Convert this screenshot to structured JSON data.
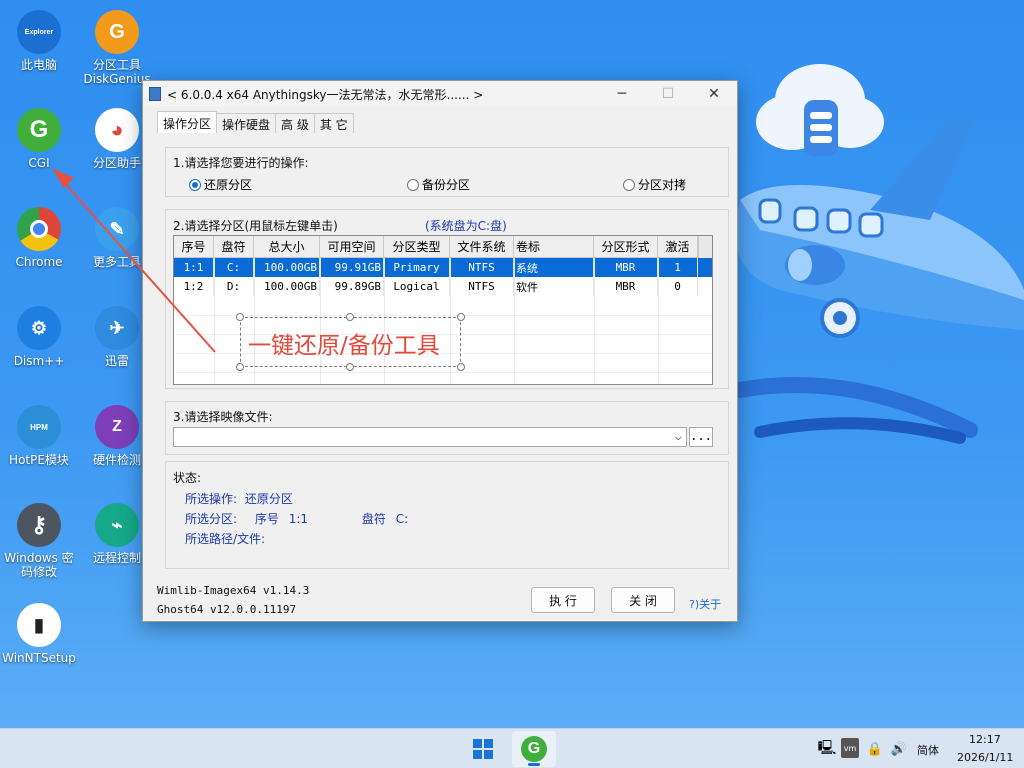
{
  "desktop": {
    "icons": [
      {
        "label": "此电脑",
        "glyph": "Explorer",
        "color": "#1a6fd1"
      },
      {
        "label": "分区工具\nDiskGenius",
        "glyph": "G",
        "color": "#f29a1c"
      },
      {
        "label": "CGI",
        "glyph": "G",
        "color": "#3fae3a"
      },
      {
        "label": "分区助手",
        "glyph": "◕",
        "color": "#ffffff"
      },
      {
        "label": "Chrome",
        "glyph": "●",
        "color": "#ffffff"
      },
      {
        "label": "更多工具",
        "glyph": "✎",
        "color": "#3aa0ee"
      },
      {
        "label": "Dism++",
        "glyph": "⚙",
        "color": "#1f7fe0"
      },
      {
        "label": "迅雷",
        "glyph": "✈",
        "color": "#2f8be0"
      },
      {
        "label": "HotPE模块",
        "glyph": "HPM",
        "color": "#2d8ed8"
      },
      {
        "label": "硬件检测",
        "glyph": "Z",
        "color": "#7d3fb8"
      },
      {
        "label": "Windows 密\n码修改",
        "glyph": "⚷",
        "color": "#4d5560"
      },
      {
        "label": "远程控制",
        "glyph": "⌁",
        "color": "#17a88a"
      },
      {
        "label": "WinNTSetup",
        "glyph": "▮",
        "color": "#ffffff"
      }
    ]
  },
  "annotation": {
    "text": "一键还原/备份工具",
    "color": "#e24a3b"
  },
  "dialog": {
    "title": "< 6.0.0.4 x64 Anythingsky一法无常法，水无常形...... >",
    "tabs": [
      "操作分区",
      "操作硬盘",
      "高 级",
      "其 它"
    ],
    "step1": {
      "label": "1.请选择您要进行的操作:",
      "options": [
        "还原分区",
        "备份分区",
        "分区对拷"
      ],
      "selected": "还原分区"
    },
    "step2": {
      "label": "2.请选择分区(用鼠标左键单击)",
      "hint": "(系统盘为C:盘)",
      "columns": [
        "序号",
        "盘符",
        "总大小",
        "可用空间",
        "分区类型",
        "文件系统",
        "卷标",
        "分区形式",
        "激活"
      ],
      "rows": [
        [
          "1:1",
          "C:",
          "100.00GB",
          "99.91GB",
          "Primary",
          "NTFS",
          "系统",
          "MBR",
          "1"
        ],
        [
          "1:2",
          "D:",
          "100.00GB",
          "99.89GB",
          "Logical",
          "NTFS",
          "软件",
          "MBR",
          "0"
        ]
      ],
      "selected_row": 0
    },
    "step3": {
      "label": "3.请选择映像文件:",
      "value": "",
      "browse_label": "..."
    },
    "status": {
      "label": "状态:",
      "op_label": "所选操作:",
      "op_value": "还原分区",
      "part_label": "所选分区:",
      "part_index_label": "序号",
      "part_index": "1:1",
      "drive_label": "盘符",
      "drive": "C:",
      "path_label": "所选路径/文件:"
    },
    "footer": {
      "wimlib": "Wimlib-Imagex64 v1.14.3",
      "ghost": "Ghost64 v12.0.0.11197",
      "execute": "执 行",
      "close": "关 闭",
      "about": "?)关于"
    }
  },
  "taskbar": {
    "lang": "简体",
    "time": "12:17",
    "date": "2026/1/11"
  }
}
